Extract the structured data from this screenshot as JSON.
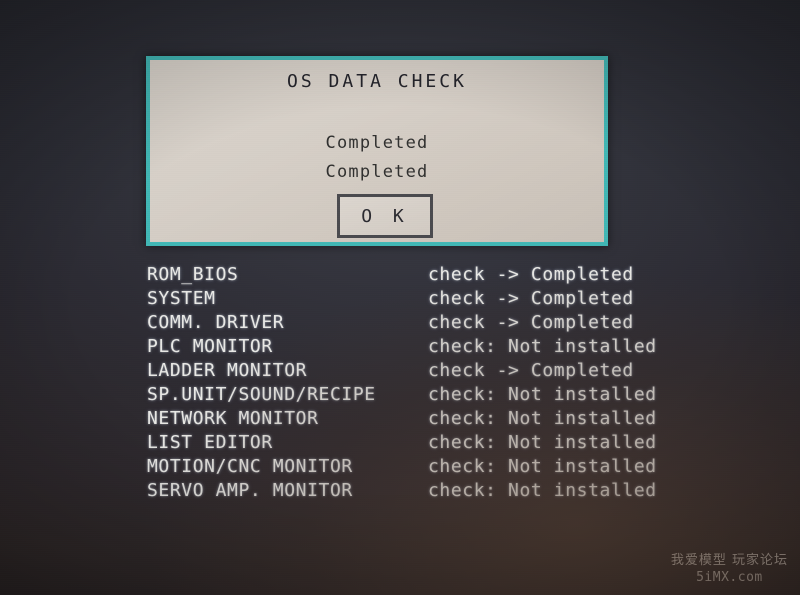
{
  "screen": {
    "background_color": "#2b2b33",
    "accent_color": "#41b7b5",
    "text_color": "#e9e9e6"
  },
  "dialog": {
    "title": "OS DATA CHECK",
    "border_color": "#41b7b5",
    "background_color": "#d5cec7",
    "messages": [
      "Completed",
      "Completed"
    ],
    "ok_label": "O K"
  },
  "check_list": {
    "rows": [
      {
        "name": "ROM_BIOS",
        "status": "check -> Completed"
      },
      {
        "name": "SYSTEM",
        "status": "check -> Completed"
      },
      {
        "name": "COMM. DRIVER",
        "status": "check -> Completed"
      },
      {
        "name": "PLC MONITOR",
        "status": "check: Not installed"
      },
      {
        "name": "LADDER MONITOR",
        "status": "check -> Completed"
      },
      {
        "name": "SP.UNIT/SOUND/RECIPE",
        "status": "check: Not installed"
      },
      {
        "name": "NETWORK MONITOR",
        "status": "check: Not installed"
      },
      {
        "name": "LIST EDITOR",
        "status": "check: Not installed"
      },
      {
        "name": "MOTION/CNC MONITOR",
        "status": "check: Not installed"
      },
      {
        "name": "SERVO AMP. MONITOR",
        "status": "check: Not installed"
      }
    ]
  },
  "watermark": {
    "line1": "我爱模型 玩家论坛",
    "line2": "5iMX.com"
  }
}
